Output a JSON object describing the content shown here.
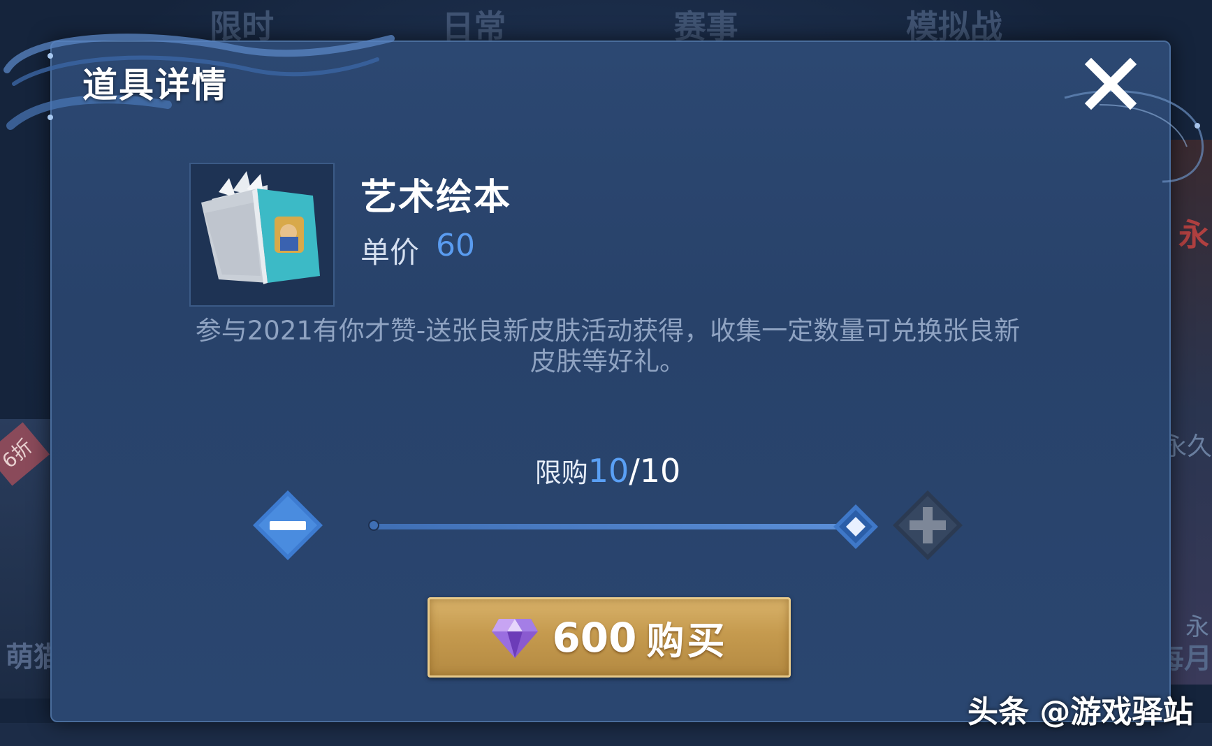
{
  "background": {
    "tabs": [
      "限时",
      "日常",
      "赛事",
      "模拟战"
    ],
    "left_badge": "6折",
    "left_text": "萌猫",
    "right_texts": [
      "永",
      "每永久",
      "永",
      "每月"
    ]
  },
  "dialog": {
    "title": "道具详情",
    "close_icon": "close-icon"
  },
  "item": {
    "icon": "art-picture-book-icon",
    "name": "艺术绘本",
    "price_label": "单价",
    "price_value": "60",
    "description": "参与2021有你才赞-送张良新皮肤活动获得，收集一定数量可兑换张良新皮肤等好礼。"
  },
  "purchase_limit": {
    "label": "限购",
    "current": "10",
    "separator": "/",
    "max": "10",
    "slider_fraction": 1.0
  },
  "buy_button": {
    "icon": "diamond-gem-icon",
    "amount": "600",
    "label": "购买"
  },
  "watermark": "头条 @游戏驿站",
  "colors": {
    "accent_blue": "#5aa0f5",
    "button_gold": "#c59a4e"
  }
}
